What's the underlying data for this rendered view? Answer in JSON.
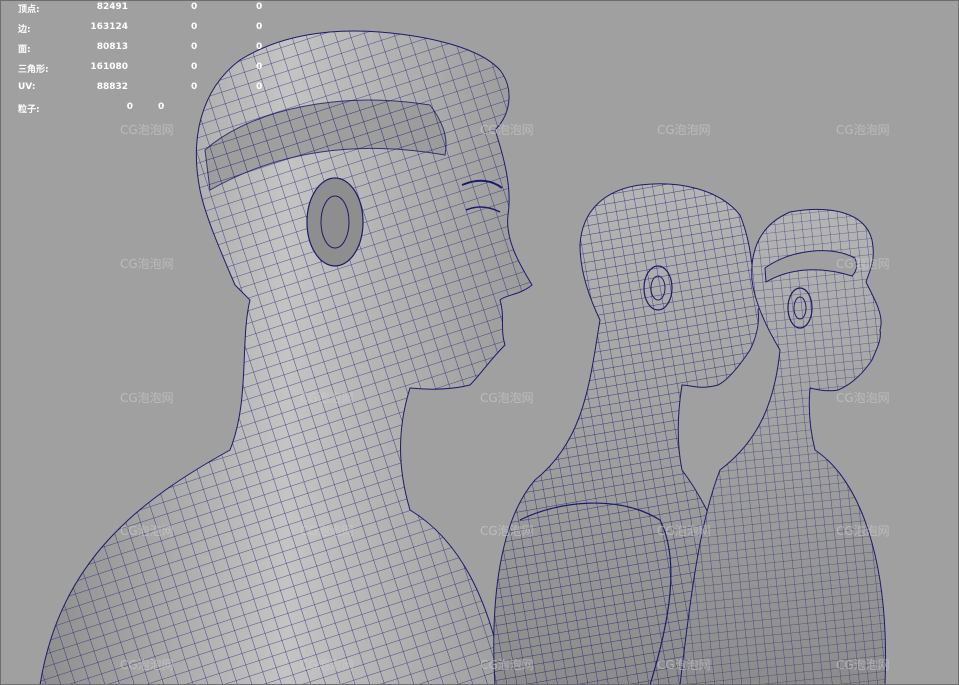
{
  "hud": {
    "rows": [
      {
        "label": "顶点:",
        "total": "82491",
        "selected": "0",
        "extra": "0"
      },
      {
        "label": "边:",
        "total": "163124",
        "selected": "0",
        "extra": "0"
      },
      {
        "label": "面:",
        "total": "80813",
        "selected": "0",
        "extra": "0"
      },
      {
        "label": "三角形:",
        "total": "161080",
        "selected": "0",
        "extra": "0"
      },
      {
        "label": "UV:",
        "total": "88832",
        "selected": "0",
        "extra": "0"
      },
      {
        "label": "粒子:",
        "total": "0",
        "selected": "0",
        "extra": ""
      }
    ]
  },
  "watermark": {
    "text": "CG泡泡网"
  },
  "colors": {
    "viewport_bg": "#a0a0a0",
    "wire": "#1a1a6e",
    "skin": "#b8b8b8"
  }
}
